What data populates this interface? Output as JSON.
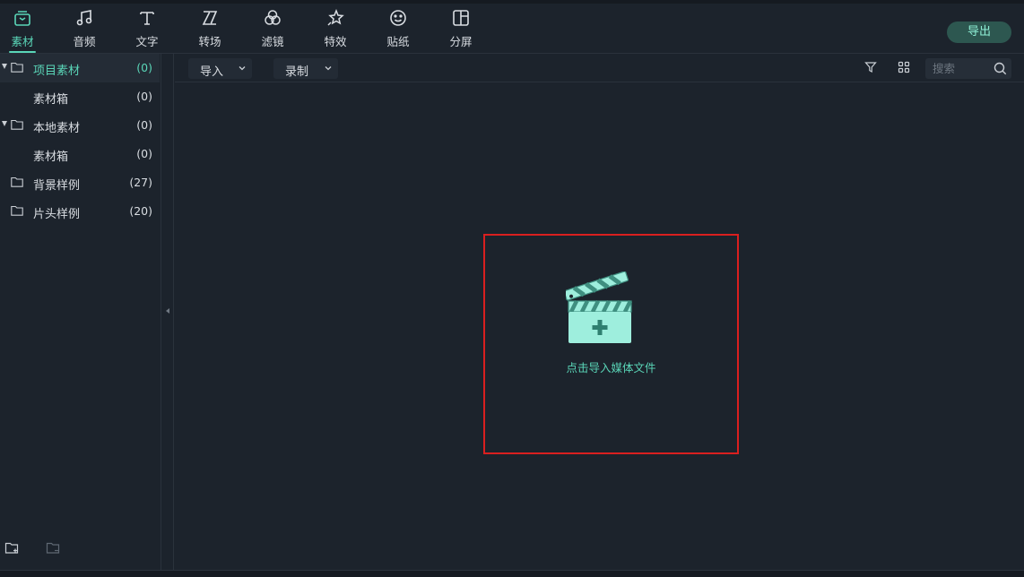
{
  "toolbar": {
    "tabs": [
      {
        "label": "素材",
        "icon": "media-icon",
        "active": true
      },
      {
        "label": "音频",
        "icon": "music-note-icon"
      },
      {
        "label": "文字",
        "icon": "text-icon"
      },
      {
        "label": "转场",
        "icon": "transition-icon"
      },
      {
        "label": "滤镜",
        "icon": "filter-circles-icon"
      },
      {
        "label": "特效",
        "icon": "star-effect-icon"
      },
      {
        "label": "贴纸",
        "icon": "sticker-smiley-icon"
      },
      {
        "label": "分屏",
        "icon": "split-screen-icon"
      }
    ],
    "export_label": "导出"
  },
  "sidebar": {
    "items": [
      {
        "name": "项目素材",
        "count": "(0)",
        "expanded": true,
        "selected": true
      },
      {
        "name": "素材箱",
        "count": "(0)"
      },
      {
        "name": "本地素材",
        "count": "(0)",
        "expanded": true
      },
      {
        "name": "素材箱",
        "count": "(0)"
      },
      {
        "name": "背景样例",
        "count": "(27)"
      },
      {
        "name": "片头样例",
        "count": "(20)"
      }
    ]
  },
  "subbar": {
    "import_label": "导入",
    "record_label": "录制",
    "search_placeholder": "搜索"
  },
  "main": {
    "drop_label": "点击导入媒体文件"
  },
  "colors": {
    "accent": "#5ad6b8",
    "background": "#1c232c",
    "highlight_border": "#d91f1f",
    "export_button": "#2d5750"
  }
}
